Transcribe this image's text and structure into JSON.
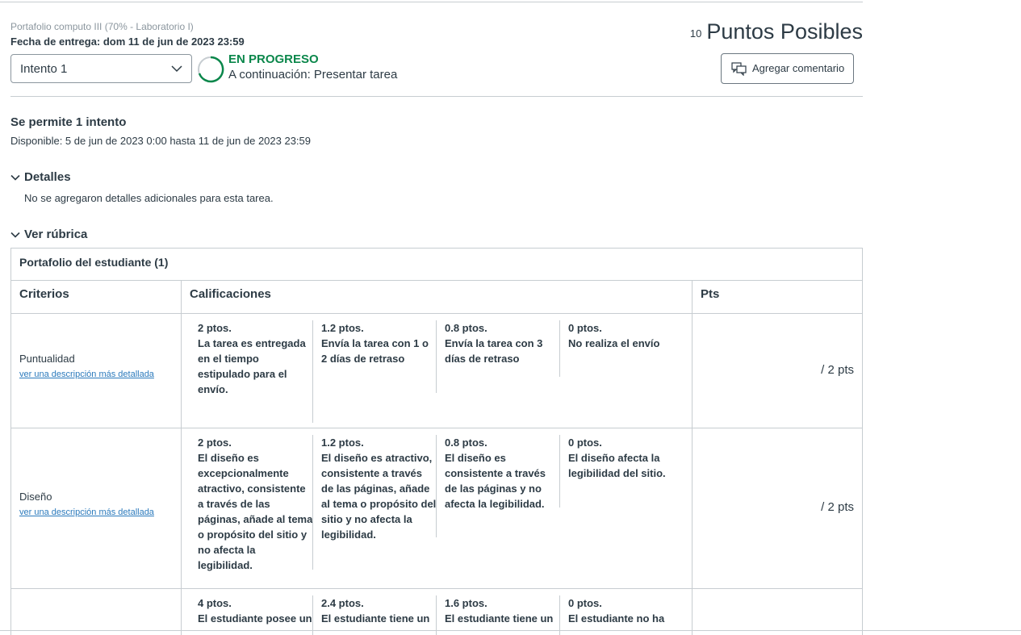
{
  "header": {
    "crumb": "Portafolio computo III (70% - Laboratorio I)",
    "due_date": "Fecha de entrega: dom 11 de jun de 2023 23:59",
    "attempt_select": "Intento 1",
    "status": "EN PROGRESO",
    "next_step": "A continuación: Presentar tarea",
    "points_value": "10",
    "points_label": "Puntos Posibles",
    "comment_button": "Agregar comentario"
  },
  "info": {
    "allowed": "Se permite 1 intento",
    "available": "Disponible: 5 de jun de 2023 0:00 hasta 11 de jun de 2023 23:59"
  },
  "details": {
    "toggle": "Detalles",
    "text": "No se agregaron detalles adicionales para esta tarea."
  },
  "rubric": {
    "toggle": "Ver rúbrica",
    "title": "Portafolio del estudiante (1)",
    "col_criteria": "Criterios",
    "col_ratings": "Calificaciones",
    "col_pts": "Pts",
    "rows": [
      {
        "name": "Puntualidad",
        "link": "ver una descripción más detallada",
        "pts": "/ 2 pts",
        "ratings": [
          {
            "points": "2 ptos.",
            "desc": "La tarea es entregada en el tiempo estipulado para el envío."
          },
          {
            "points": "1.2 ptos.",
            "desc": "Envía la tarea con 1 o 2 días de retraso"
          },
          {
            "points": "0.8 ptos.",
            "desc": "Envía la tarea con 3 días de retraso"
          },
          {
            "points": "0 ptos.",
            "desc": "No realiza el envío"
          }
        ]
      },
      {
        "name": "Diseño",
        "link": "ver una descripción más detallada",
        "pts": "/ 2 pts",
        "ratings": [
          {
            "points": "2 ptos.",
            "desc": "El diseño es excepcionalmente atractivo, consistente a través de las páginas, añade al tema o propósito del sitio y no afecta la legibilidad."
          },
          {
            "points": "1.2 ptos.",
            "desc": "El diseño es atractivo, consistente a través de las páginas, añade al tema o propósito del sitio y no afecta la legibilidad."
          },
          {
            "points": "0.8 ptos.",
            "desc": "El diseño es consistente a través de las páginas y no afecta la legibilidad."
          },
          {
            "points": "0 ptos.",
            "desc": "El diseño afecta la legibilidad del sitio."
          }
        ]
      },
      {
        "name": "",
        "link": "",
        "pts": "",
        "ratings": [
          {
            "points": "4 ptos.",
            "desc": "El estudiante posee un"
          },
          {
            "points": "2.4 ptos.",
            "desc": "El estudiante tiene un"
          },
          {
            "points": "1.6 ptos.",
            "desc": "El estudiante tiene un"
          },
          {
            "points": "0 ptos.",
            "desc": "El estudiante no ha"
          }
        ]
      }
    ]
  }
}
